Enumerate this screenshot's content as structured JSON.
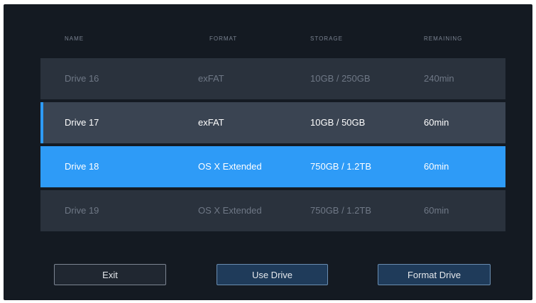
{
  "table": {
    "headers": [
      "NAME",
      "FORMAT",
      "STORAGE",
      "REMAINING"
    ],
    "rows": [
      {
        "name": "Drive 16",
        "format": "exFAT",
        "storage": "10GB / 250GB",
        "remaining": "240min",
        "state": "dim"
      },
      {
        "name": "Drive 17",
        "format": "exFAT",
        "storage": "10GB / 50GB",
        "remaining": "60min",
        "state": "focused"
      },
      {
        "name": "Drive 18",
        "format": "OS X Extended",
        "storage": "750GB / 1.2TB",
        "remaining": "60min",
        "state": "selected"
      },
      {
        "name": "Drive 19",
        "format": "OS X Extended",
        "storage": "750GB / 1.2TB",
        "remaining": "60min",
        "state": "dim"
      }
    ]
  },
  "buttons": {
    "exit": "Exit",
    "use_drive": "Use Drive",
    "format_drive": "Format Drive"
  },
  "colors": {
    "background": "#141a22",
    "accent": "#2e9bf7",
    "row": "#2e3743"
  }
}
